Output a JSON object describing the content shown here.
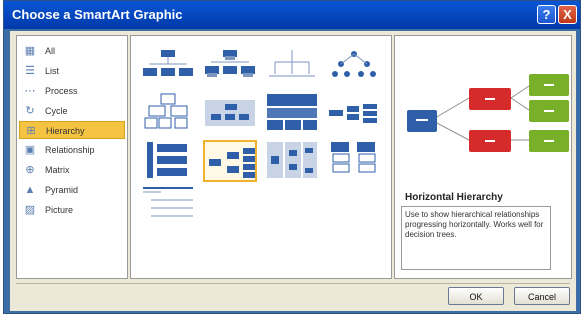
{
  "window": {
    "title": "Choose a SmartArt Graphic",
    "help": "?",
    "close": "X"
  },
  "categories": [
    {
      "label": "All",
      "icon": "grid-icon"
    },
    {
      "label": "List",
      "icon": "list-icon"
    },
    {
      "label": "Process",
      "icon": "process-icon"
    },
    {
      "label": "Cycle",
      "icon": "cycle-icon"
    },
    {
      "label": "Hierarchy",
      "icon": "hierarchy-icon",
      "selected": true
    },
    {
      "label": "Relationship",
      "icon": "relationship-icon"
    },
    {
      "label": "Matrix",
      "icon": "matrix-icon"
    },
    {
      "label": "Pyramid",
      "icon": "pyramid-icon"
    },
    {
      "label": "Picture",
      "icon": "picture-icon"
    }
  ],
  "preview": {
    "title": "Horizontal Hierarchy",
    "description": "Use to show hierarchical relationships progressing horizontally. Works well for decision trees."
  },
  "buttons": {
    "ok": "OK",
    "cancel": "Cancel"
  },
  "colors": {
    "blue": "#2f5fa8",
    "red": "#d62b2b",
    "green": "#79b02a",
    "selection": "#f5c342"
  }
}
